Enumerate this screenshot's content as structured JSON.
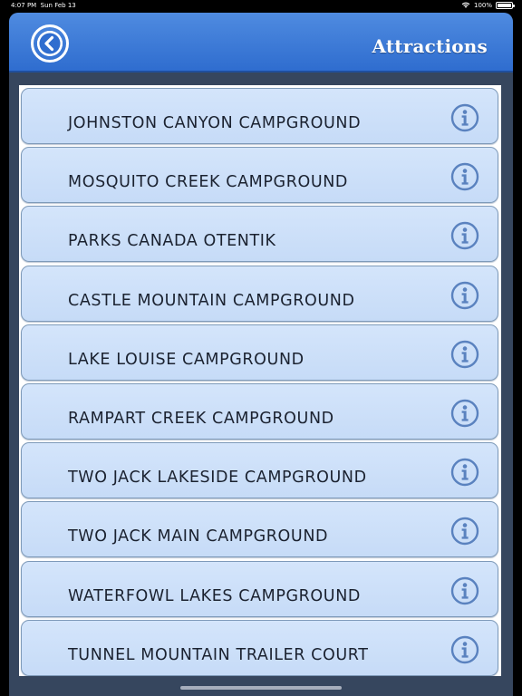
{
  "status_bar": {
    "time": "4:07 PM",
    "date": "Sun Feb 13",
    "battery": "100%"
  },
  "nav": {
    "title": "Attractions",
    "back_icon": "chevron-left-circle-icon"
  },
  "colors": {
    "nav_blue": "#3a78d8",
    "item_fill": "#cfe1f9",
    "item_border": "#7e9ab9",
    "info_icon": "#5a82bf",
    "app_background": "#36465e"
  },
  "list": {
    "info_icon": "info-icon",
    "items": [
      {
        "label": "JOHNSTON CANYON CAMPGROUND"
      },
      {
        "label": "MOSQUITO CREEK CAMPGROUND"
      },
      {
        "label": "PARKS CANADA OTENTIK"
      },
      {
        "label": "CASTLE MOUNTAIN CAMPGROUND"
      },
      {
        "label": "LAKE LOUISE CAMPGROUND"
      },
      {
        "label": "RAMPART CREEK CAMPGROUND"
      },
      {
        "label": "TWO JACK LAKESIDE CAMPGROUND"
      },
      {
        "label": "TWO JACK MAIN CAMPGROUND"
      },
      {
        "label": "WATERFOWL LAKES CAMPGROUND"
      },
      {
        "label": "TUNNEL MOUNTAIN TRAILER COURT"
      }
    ]
  }
}
